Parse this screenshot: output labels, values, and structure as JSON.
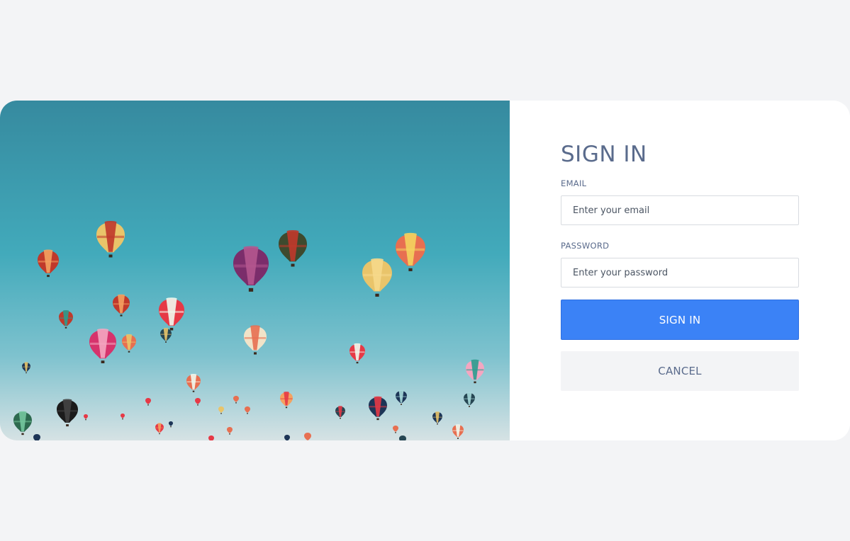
{
  "hero": {
    "image": "hot-air-balloons-photo"
  },
  "form": {
    "title": "SIGN IN",
    "email": {
      "label": "EMAIL",
      "placeholder": "Enter your email",
      "value": ""
    },
    "password": {
      "label": "PASSWORD",
      "placeholder": "Enter your password",
      "value": ""
    },
    "submit_label": "SIGN IN",
    "cancel_label": "CANCEL"
  },
  "colors": {
    "primary": "#3b82f6",
    "heading": "#5a6b8c",
    "page_background": "#f3f4f6",
    "sky_top": "#368a9f",
    "sky_bottom": "#cfdfe3"
  }
}
